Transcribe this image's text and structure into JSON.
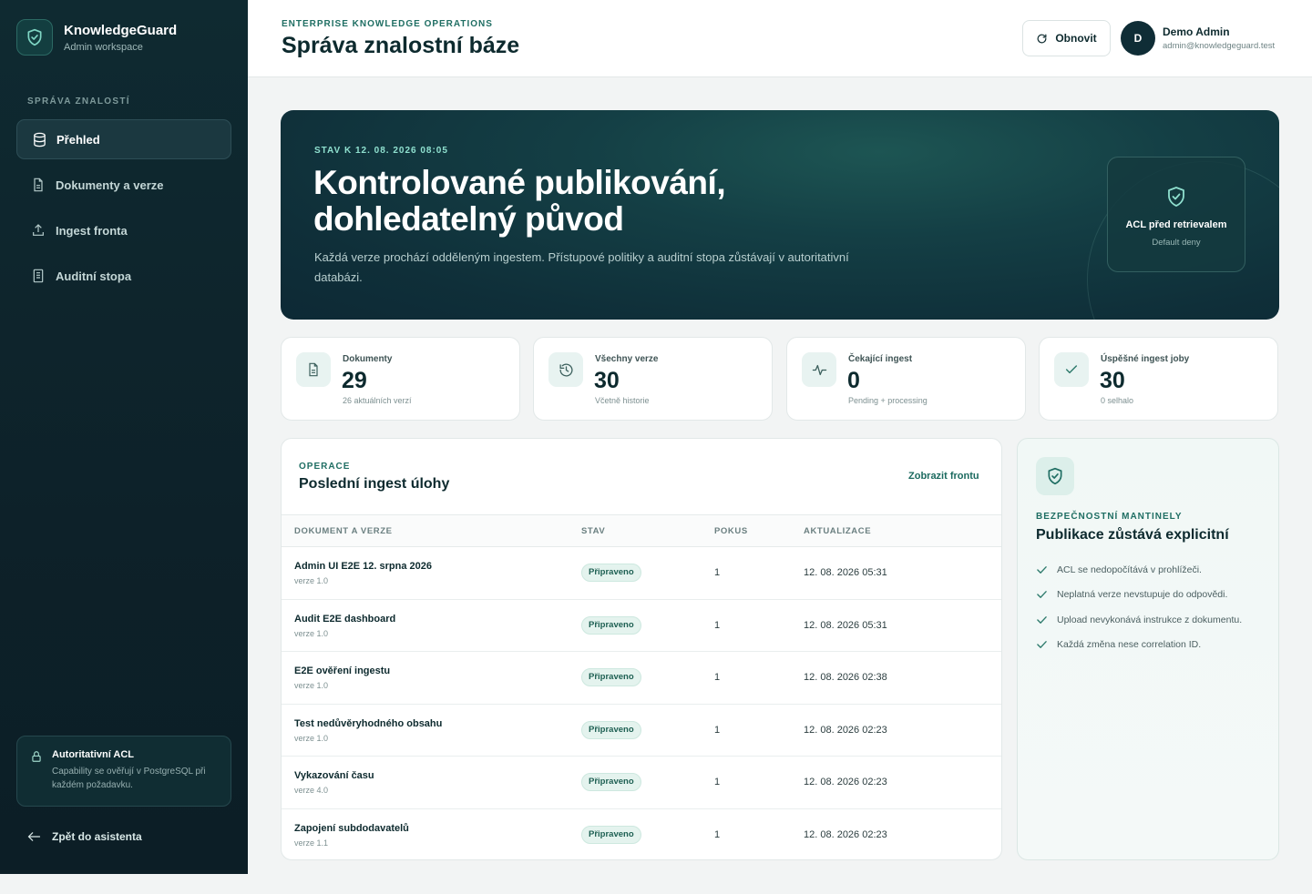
{
  "brand": {
    "name": "KnowledgeGuard",
    "subtitle": "Admin workspace"
  },
  "sidebar": {
    "section_label": "SPRÁVA ZNALOSTÍ",
    "items": [
      {
        "label": "Přehled",
        "icon": "database-icon",
        "active": true
      },
      {
        "label": "Dokumenty a verze",
        "icon": "document-icon",
        "active": false
      },
      {
        "label": "Ingest fronta",
        "icon": "upload-icon",
        "active": false
      },
      {
        "label": "Auditní stopa",
        "icon": "list-document-icon",
        "active": false
      }
    ],
    "acl_card": {
      "title": "Autoritativní ACL",
      "description": "Capability se ověřují v PostgreSQL při každém požadavku."
    },
    "back_label": "Zpět do asistenta"
  },
  "header": {
    "eyebrow": "ENTERPRISE KNOWLEDGE OPERATIONS",
    "title": "Správa znalostní báze",
    "refresh_label": "Obnovit",
    "user": {
      "initial": "D",
      "name": "Demo Admin",
      "email": "admin@knowledgeguard.test"
    }
  },
  "hero": {
    "eyebrow": "STAV K 12. 08. 2026 08:05",
    "title": "Kontrolované publikování, dohledatelný původ",
    "description": "Každá verze prochází odděleným ingestem. Přístupové politiky a auditní stopa zůstávají v autoritativní databázi.",
    "badge": {
      "title": "ACL před retrievalem",
      "subtitle": "Default deny"
    }
  },
  "stats": [
    {
      "label": "Dokumenty",
      "value": "29",
      "sub": "26 aktuálních verzí",
      "icon": "document-icon"
    },
    {
      "label": "Všechny verze",
      "value": "30",
      "sub": "Včetně historie",
      "icon": "history-icon"
    },
    {
      "label": "Čekající ingest",
      "value": "0",
      "sub": "Pending + processing",
      "icon": "activity-icon"
    },
    {
      "label": "Úspěšné ingest joby",
      "value": "30",
      "sub": "0 selhalo",
      "icon": "check-icon"
    }
  ],
  "operations": {
    "eyebrow": "OPERACE",
    "title": "Poslední ingest úlohy",
    "link": "Zobrazit frontu",
    "columns": [
      "DOKUMENT A VERZE",
      "STAV",
      "POKUS",
      "AKTUALIZACE"
    ],
    "rows": [
      {
        "name": "Admin UI E2E 12. srpna 2026",
        "version": "verze 1.0",
        "status": "Připraveno",
        "attempt": "1",
        "updated": "12. 08. 2026 05:31"
      },
      {
        "name": "Audit E2E dashboard",
        "version": "verze 1.0",
        "status": "Připraveno",
        "attempt": "1",
        "updated": "12. 08. 2026 05:31"
      },
      {
        "name": "E2E ověření ingestu",
        "version": "verze 1.0",
        "status": "Připraveno",
        "attempt": "1",
        "updated": "12. 08. 2026 02:38"
      },
      {
        "name": "Test nedůvěryhodného obsahu",
        "version": "verze 1.0",
        "status": "Připraveno",
        "attempt": "1",
        "updated": "12. 08. 2026 02:23"
      },
      {
        "name": "Vykazování času",
        "version": "verze 4.0",
        "status": "Připraveno",
        "attempt": "1",
        "updated": "12. 08. 2026 02:23"
      },
      {
        "name": "Zapojení subdodavatelů",
        "version": "verze 1.1",
        "status": "Připraveno",
        "attempt": "1",
        "updated": "12. 08. 2026 02:23"
      }
    ]
  },
  "guardrails": {
    "eyebrow": "BEZPEČNOSTNÍ MANTINELY",
    "title": "Publikace zůstává explicitní",
    "items": [
      "ACL se nedopočítává v prohlížeči.",
      "Neplatná verze nevstupuje do odpovědi.",
      "Upload nevykonává instrukce z dokumentu.",
      "Každá změna nese correlation ID."
    ]
  },
  "colors": {
    "sidebar_bg": "#0f2a31",
    "accent": "#1f6e63",
    "hero_bg": "#143f45",
    "status_ready": "#1d5f52"
  }
}
